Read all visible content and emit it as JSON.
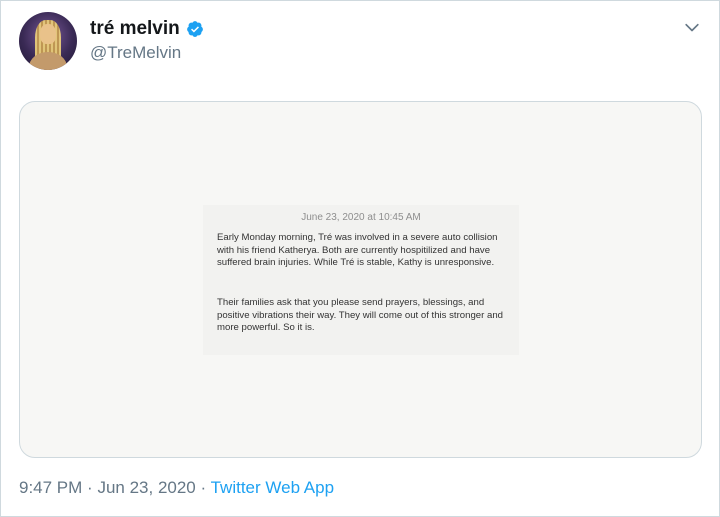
{
  "tweet": {
    "display_name": "tré melvin",
    "handle": "@TreMelvin",
    "time": "9:47 PM",
    "date": "Jun 23, 2020",
    "separator": "·",
    "source": "Twitter Web App"
  },
  "icons": {
    "verified": "verified-badge-icon",
    "menu": "chevron-down-icon"
  },
  "colors": {
    "verified_blue": "#1da1f2",
    "link_blue": "#1da1f2",
    "secondary_text": "#657786"
  },
  "image_note": {
    "date": "June 23, 2020 at 10:45 AM",
    "paragraph1": "Early Monday morning, Tré was involved in a severe auto collision with his friend Katherya. Both are currently hospitilized and have suffered brain injuries. While Tré is stable, Kathy is unresponsive.",
    "paragraph2": "Their families ask that you please send prayers, blessings, and positive vibrations their way. They will come out of this stronger and more powerful. So it is."
  }
}
